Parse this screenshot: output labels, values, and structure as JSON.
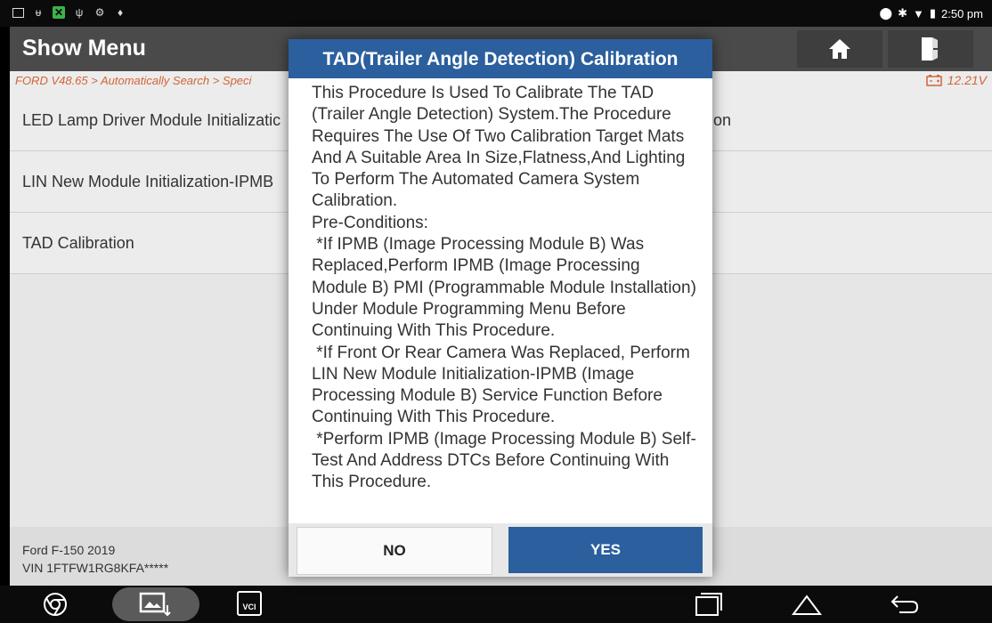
{
  "statusbar": {
    "time": "2:50 pm"
  },
  "header": {
    "title": "Show Menu",
    "home_icon": "home-icon",
    "exit_icon": "exit-icon"
  },
  "breadcrumb": {
    "path": "FORD V48.65 > Automatically Search > Speci",
    "voltage": "12.21V"
  },
  "menu": {
    "items": [
      {
        "label": "LED Lamp Driver Module Initializatic",
        "right": "ion"
      },
      {
        "label": "LIN New Module Initialization-IPMB",
        "right": ""
      },
      {
        "label": "TAD Calibration",
        "right": ""
      }
    ]
  },
  "footer": {
    "vehicle": "Ford F-150 2019",
    "vin": "VIN 1FTFW1RG8KFA*****"
  },
  "dialog": {
    "title": "TAD(Trailer Angle Detection) Calibration",
    "body": "This Procedure Is Used To Calibrate The TAD (Trailer Angle Detection) System.The Procedure Requires The Use Of Two Calibration Target Mats And A Suitable Area In Size,Flatness,And Lighting To Perform The Automated Camera System Calibration.\nPre-Conditions:\n *If IPMB (Image Processing Module B) Was Replaced,Perform IPMB (Image Processing Module B) PMI (Programmable Module Installation) Under Module Programming Menu Before Continuing With This Procedure.\n *If Front Or Rear Camera Was Replaced, Perform LIN New Module Initialization-IPMB (Image Processing Module B) Service Function Before Continuing With This Procedure.\n *Perform IPMB (Image Processing Module B) Self-Test And Address DTCs Before Continuing With This Procedure.",
    "no_label": "NO",
    "yes_label": "YES"
  },
  "navbar": {
    "vci_label": "VCI"
  }
}
